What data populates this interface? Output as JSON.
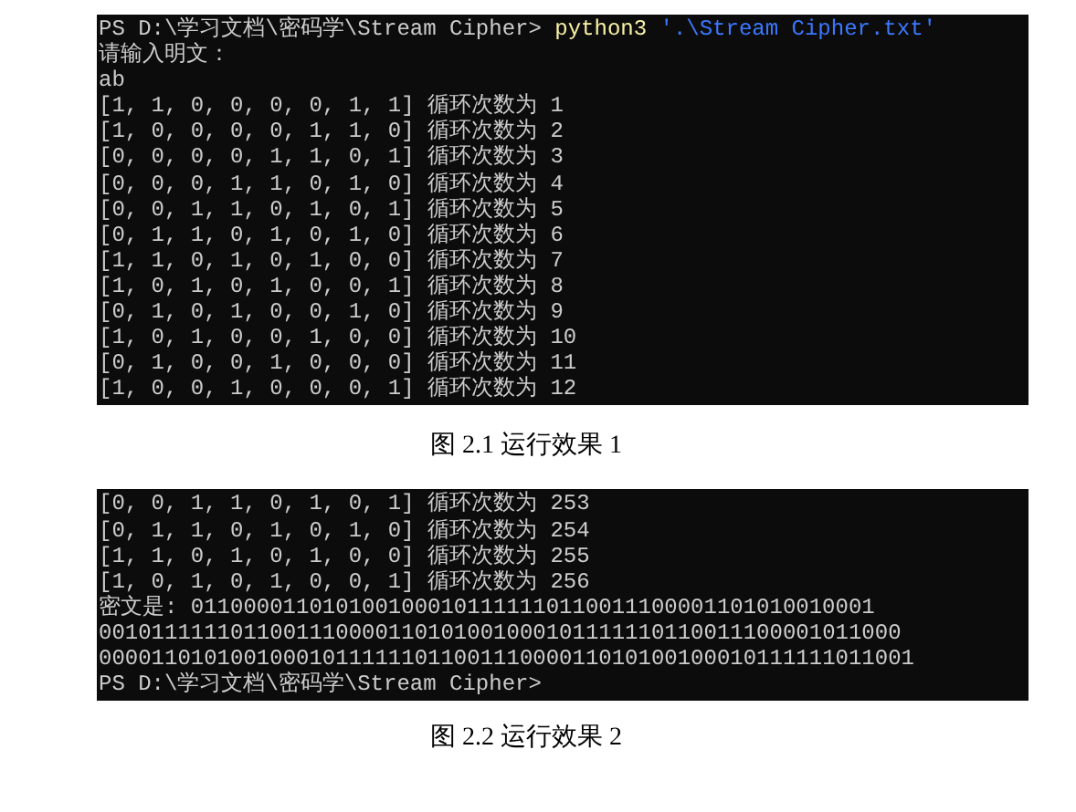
{
  "figures": [
    {
      "terminal": [
        {
          "kind": "command",
          "prompt": "PS D:\\学习文档\\密码学\\Stream Cipher>",
          "program": "python3",
          "argument": "'.\\Stream Cipher.txt'"
        },
        {
          "kind": "output",
          "text": "请输入明文："
        },
        {
          "kind": "output",
          "text": "ab"
        },
        {
          "kind": "output",
          "text": "[1, 1, 0, 0, 0, 0, 1, 1] 循环次数为 1"
        },
        {
          "kind": "output",
          "text": "[1, 0, 0, 0, 0, 1, 1, 0] 循环次数为 2"
        },
        {
          "kind": "output",
          "text": "[0, 0, 0, 0, 1, 1, 0, 1] 循环次数为 3"
        },
        {
          "kind": "output",
          "text": "[0, 0, 0, 1, 1, 0, 1, 0] 循环次数为 4"
        },
        {
          "kind": "output",
          "text": "[0, 0, 1, 1, 0, 1, 0, 1] 循环次数为 5"
        },
        {
          "kind": "output",
          "text": "[0, 1, 1, 0, 1, 0, 1, 0] 循环次数为 6"
        },
        {
          "kind": "output",
          "text": "[1, 1, 0, 1, 0, 1, 0, 0] 循环次数为 7"
        },
        {
          "kind": "output",
          "text": "[1, 0, 1, 0, 1, 0, 0, 1] 循环次数为 8"
        },
        {
          "kind": "output",
          "text": "[0, 1, 0, 1, 0, 0, 1, 0] 循环次数为 9"
        },
        {
          "kind": "output",
          "text": "[1, 0, 1, 0, 0, 1, 0, 0] 循环次数为 10"
        },
        {
          "kind": "output",
          "text": "[0, 1, 0, 0, 1, 0, 0, 0] 循环次数为 11"
        },
        {
          "kind": "output",
          "text": "[1, 0, 0, 1, 0, 0, 0, 1] 循环次数为 12"
        }
      ],
      "caption": "图 2.1  运行效果 1"
    },
    {
      "terminal": [
        {
          "kind": "output",
          "text": "[0, 0, 1, 1, 0, 1, 0, 1] 循环次数为 253"
        },
        {
          "kind": "output",
          "text": "[0, 1, 1, 0, 1, 0, 1, 0] 循环次数为 254"
        },
        {
          "kind": "output",
          "text": "[1, 1, 0, 1, 0, 1, 0, 0] 循环次数为 255"
        },
        {
          "kind": "output",
          "text": "[1, 0, 1, 0, 1, 0, 0, 1] 循环次数为 256"
        },
        {
          "kind": "output",
          "text": "密文是: 0110000110101001000101111110110011100001101010010001"
        },
        {
          "kind": "output",
          "text": "0010111111011001110000110101001000101111110110011100001011000"
        },
        {
          "kind": "output",
          "text": "00001101010010001011111101100111000011010100100010111111011001"
        },
        {
          "kind": "output",
          "text": "PS D:\\学习文档\\密码学\\Stream Cipher>"
        }
      ],
      "caption": "图 2.2  运行效果 2"
    }
  ]
}
